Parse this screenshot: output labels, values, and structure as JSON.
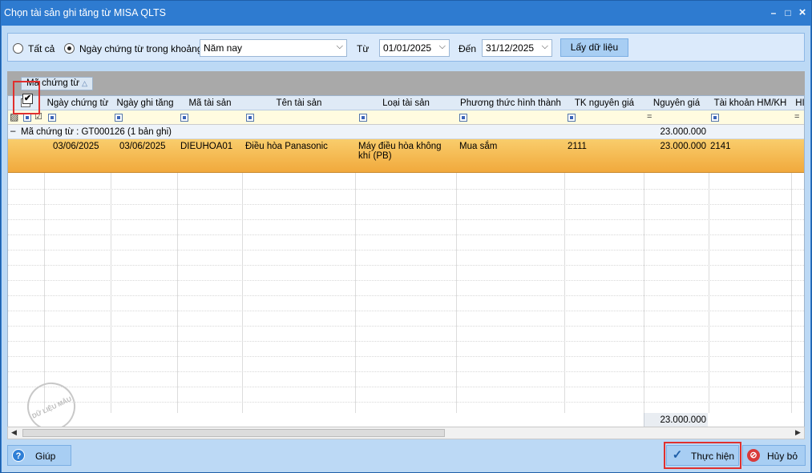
{
  "window": {
    "title": "Chọn tài sản ghi tăng từ MISA QLTS",
    "min": "–",
    "max": "□",
    "close": "×"
  },
  "filter": {
    "all_label": "Tất cả",
    "range_label": "Ngày chứng từ trong khoảng",
    "period_value": "Năm nay",
    "from_label": "Từ",
    "from_value": "01/01/2025",
    "to_label": "Đến",
    "to_value": "31/12/2025",
    "fetch_button": "Lấy dữ liệu",
    "selected_option": "range"
  },
  "group_by": {
    "tag": "Mã chứng từ",
    "sort_icon": "△"
  },
  "columns": [
    "Ngày chứng từ",
    "Ngày ghi tăng",
    "Mã tài sản",
    "Tên tài sản",
    "Loại tài sản",
    "Phương thức hình thành",
    "TK nguyên giá",
    "Nguyên giá",
    "Tài khoản HM/KH",
    "HI"
  ],
  "group_row": {
    "toggle": "–",
    "label": "Mã chứng từ : GT000126 (1 bản ghi)",
    "sum": "23.000.000"
  },
  "rows": [
    {
      "checked": true,
      "ngay_chung_tu": "03/06/2025",
      "ngay_ghi_tang": "03/06/2025",
      "ma_tai_san": "DIEUHOA01",
      "ten_tai_san": "Điều hòa Panasonic",
      "loai_tai_san": "Máy điều hòa không khí (PB)",
      "phuong_thuc": "Mua sắm",
      "tk_nguyen_gia": "2111",
      "nguyen_gia": "23.000.000",
      "tk_hmkh": "2141"
    }
  ],
  "footer_total": "23.000.000",
  "watermark": "DỮ LIỆU MẪU",
  "buttons": {
    "help": "Giúp",
    "ok": "Thực hiện",
    "cancel": "Hủy bỏ"
  },
  "colors": {
    "title_bar": "#2e7bd0",
    "row_highlight": "#f3b44a",
    "focus_outline": "#e0302e"
  }
}
